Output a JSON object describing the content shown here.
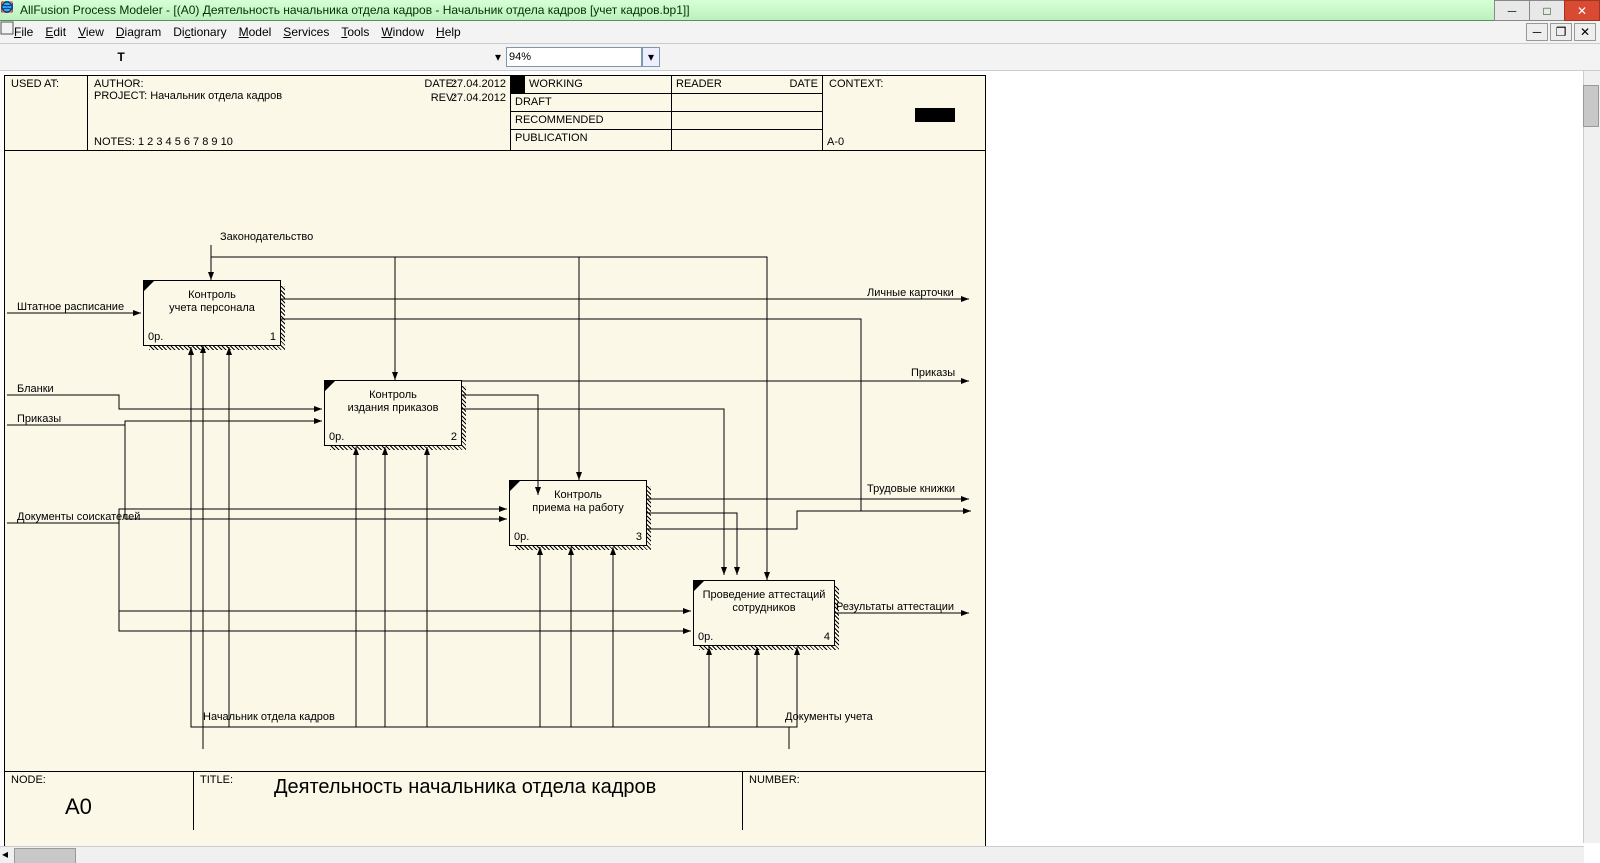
{
  "title": "AllFusion Process Modeler - [(A0) Деятельность начальника  отдела кадров - Начальник отдела кадров  [учет кадров.bp1]]",
  "menus": {
    "file": "File",
    "edit": "Edit",
    "view": "View",
    "diagram": "Diagram",
    "dictionary": "Dictionary",
    "model": "Model",
    "services": "Services",
    "tools": "Tools",
    "window": "Window",
    "help": "Help"
  },
  "zoom": "94%",
  "header": {
    "usedat": "USED AT:",
    "author": "AUTHOR:",
    "project": "PROJECT:  Начальник отдела кадров",
    "notes": "NOTES:  1  2  3  4  5  6  7  8  9  10",
    "date_l": "DATE:",
    "date_v": "27.04.2012",
    "rev_l": "REV:",
    "rev_v": "27.04.2012",
    "working": "WORKING",
    "draft": "DRAFT",
    "recommended": "RECOMMENDED",
    "publication": "PUBLICATION",
    "reader": "READER",
    "rdate": "DATE",
    "context": "CONTEXT:",
    "a0": "A-0"
  },
  "boxes": {
    "b1": {
      "t1": "Контроль",
      "t2": "учета персонала",
      "p": "0р.",
      "n": "1"
    },
    "b2": {
      "t1": "Контроль",
      "t2": "издания приказов",
      "p": "0р.",
      "n": "2"
    },
    "b3": {
      "t1": "Контроль",
      "t2": "приема на работу",
      "p": "0р.",
      "n": "3"
    },
    "b4": {
      "t1": "Проведение аттестаций",
      "t2": "сотрудников",
      "p": "0р.",
      "n": "4"
    }
  },
  "labels": {
    "top": "Законодательство",
    "in1": "Штатное расписание",
    "in2": "Бланки",
    "in3": "Приказы",
    "in4": "Документы соискателей",
    "out1": "Личные карточки",
    "out2": "Приказы",
    "out3": "Трудовые книжки",
    "out4": "Результаты аттестации",
    "mech1": "Начальник отдела кадров",
    "mech2": "Документы учета"
  },
  "footer": {
    "node_l": "NODE:",
    "node_v": "A0",
    "title_l": "TITLE:",
    "title_v": "Деятельность начальника  отдела кадров",
    "num_l": "NUMBER:"
  }
}
